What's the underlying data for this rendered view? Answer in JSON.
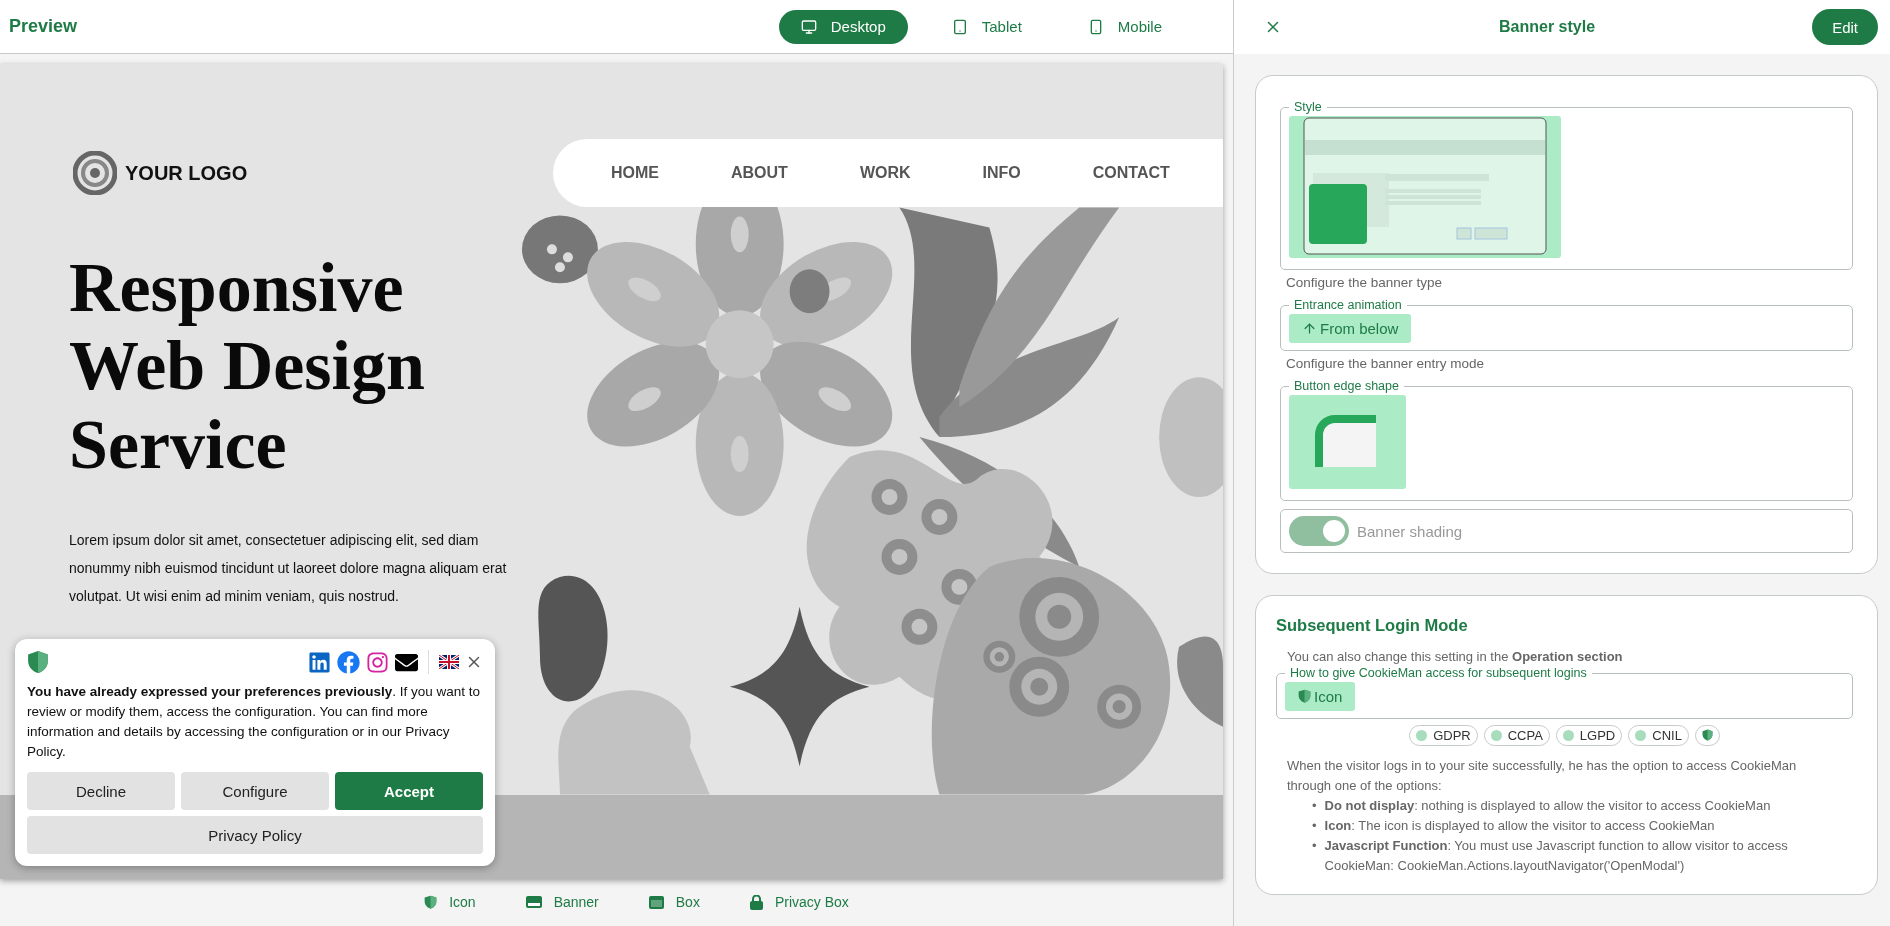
{
  "preview_header": {
    "title": "Preview",
    "devices": [
      {
        "label": "Desktop",
        "kind": "desktop",
        "selected": true
      },
      {
        "label": "Tablet",
        "kind": "tablet",
        "selected": false
      },
      {
        "label": "Mobile",
        "kind": "mobile",
        "selected": false
      }
    ]
  },
  "site": {
    "logo": "YOUR LOGO",
    "nav": [
      "HOME",
      "ABOUT",
      "WORK",
      "INFO",
      "CONTACT"
    ],
    "heading": "Responsive Web Design Service",
    "paragraph": "Lorem ipsum dolor sit amet, consectetuer adipiscing elit, sed diam nonummy nibh euismod tincidunt ut laoreet dolore magna aliquam erat volutpat. Ut wisi enim ad minim veniam, quis nostrud."
  },
  "cookie_banner": {
    "socials": [
      {
        "kind": "linkedin"
      },
      {
        "kind": "facebook"
      },
      {
        "kind": "instagram"
      },
      {
        "kind": "mail"
      }
    ],
    "message": "**You have already expressed your preferences previously**. If you want to review or modify them, access the configuration. You can find more information and details by accessing the configuration or in our Privacy Policy.",
    "buttons": [
      {
        "label": "Decline",
        "kind": "secondary"
      },
      {
        "label": "Configure",
        "kind": "secondary"
      },
      {
        "label": "Accept",
        "kind": "primary"
      }
    ],
    "privacy_button": "Privacy Policy"
  },
  "view_modes": [
    {
      "label": "Icon",
      "kind": "icon"
    },
    {
      "label": "Banner",
      "kind": "banner"
    },
    {
      "label": "Box",
      "kind": "box"
    },
    {
      "label": "Privacy Box",
      "kind": "privacy"
    }
  ],
  "panel": {
    "title": "Banner style",
    "edit_button": "Edit"
  },
  "banner_settings": {
    "style_label": "Style",
    "style_hint": "Configure the banner type",
    "animation_label": "Entrance animation",
    "animation_value": "From below",
    "animation_hint": "Configure the banner entry mode",
    "edge_label": "Button edge shape",
    "shading": {
      "label": "Banner shading",
      "on": true
    }
  },
  "login_mode": {
    "title": "Subsequent Login Mode",
    "note": "You can also change this setting in the **Operation section**",
    "field_label": "How to give CookieMan access for subsequent logins",
    "field_value": "Icon",
    "chips": [
      {
        "kind": "dot",
        "label": "GDPR"
      },
      {
        "kind": "dot",
        "label": "CCPA"
      },
      {
        "kind": "dot",
        "label": "LGPD"
      },
      {
        "kind": "dot",
        "label": "CNIL"
      },
      {
        "kind": "shield"
      }
    ],
    "description": "When the visitor logs in to your site successfully, he has the option to access CookieMan through one of the options:",
    "bullets": [
      {
        "marker": "•",
        "text": "**Do not display**: nothing is displayed to allow the visitor to access CookieMan"
      },
      {
        "marker": "•",
        "text": "**Icon**: The icon is displayed to allow the visitor to access CookieMan"
      },
      {
        "marker": "•",
        "text": "**Javascript Function**: You must use Javascript function to allow visitor to access CookieMan: CookieMan.Actions.layoutNavigator('OpenModal')"
      }
    ]
  }
}
